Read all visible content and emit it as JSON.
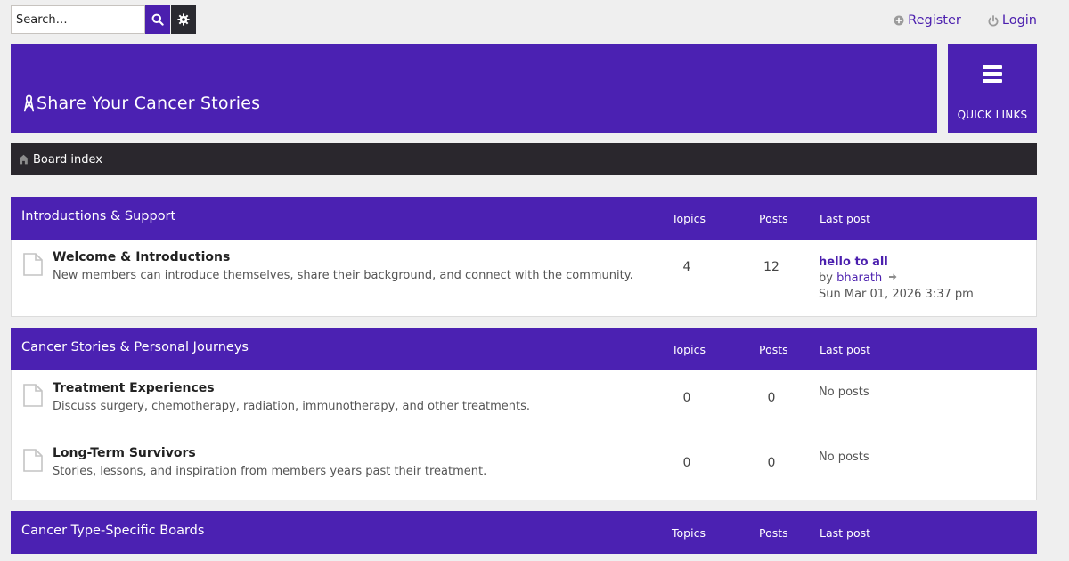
{
  "search": {
    "placeholder": "Search…"
  },
  "user_links": {
    "register": "Register",
    "login": "Login"
  },
  "header": {
    "site_title": "Share Your Cancer Stories"
  },
  "quick_links": {
    "label": "QUICK LINKS"
  },
  "breadcrumb": {
    "board_index": "Board index"
  },
  "colors": {
    "accent": "#4b21b2",
    "navbar": "#2a272d",
    "link": "#4b1fae"
  },
  "categories": [
    {
      "title": "Introductions & Support",
      "topics_label": "Topics",
      "posts_label": "Posts",
      "last_label": "Last post",
      "forums": [
        {
          "title": "Welcome & Introductions",
          "description": "New members can introduce themselves, share their background, and connect with the community.",
          "topics": "4",
          "posts": "12",
          "last_post": {
            "title": "hello to all",
            "by": "by",
            "user": "bharath",
            "date": "Sun Mar 01, 2026 3:37 pm"
          }
        }
      ]
    },
    {
      "title": "Cancer Stories & Personal Journeys",
      "topics_label": "Topics",
      "posts_label": "Posts",
      "last_label": "Last post",
      "forums": [
        {
          "title": "Treatment Experiences",
          "description": "Discuss surgery, chemotherapy, radiation, immunotherapy, and other treatments.",
          "topics": "0",
          "posts": "0",
          "no_posts": "No posts"
        },
        {
          "title": "Long-Term Survivors",
          "description": "Stories, lessons, and inspiration from members years past their treatment.",
          "topics": "0",
          "posts": "0",
          "no_posts": "No posts"
        }
      ]
    },
    {
      "title": "Cancer Type-Specific Boards",
      "topics_label": "Topics",
      "posts_label": "Posts",
      "last_label": "Last post",
      "forums": []
    }
  ]
}
